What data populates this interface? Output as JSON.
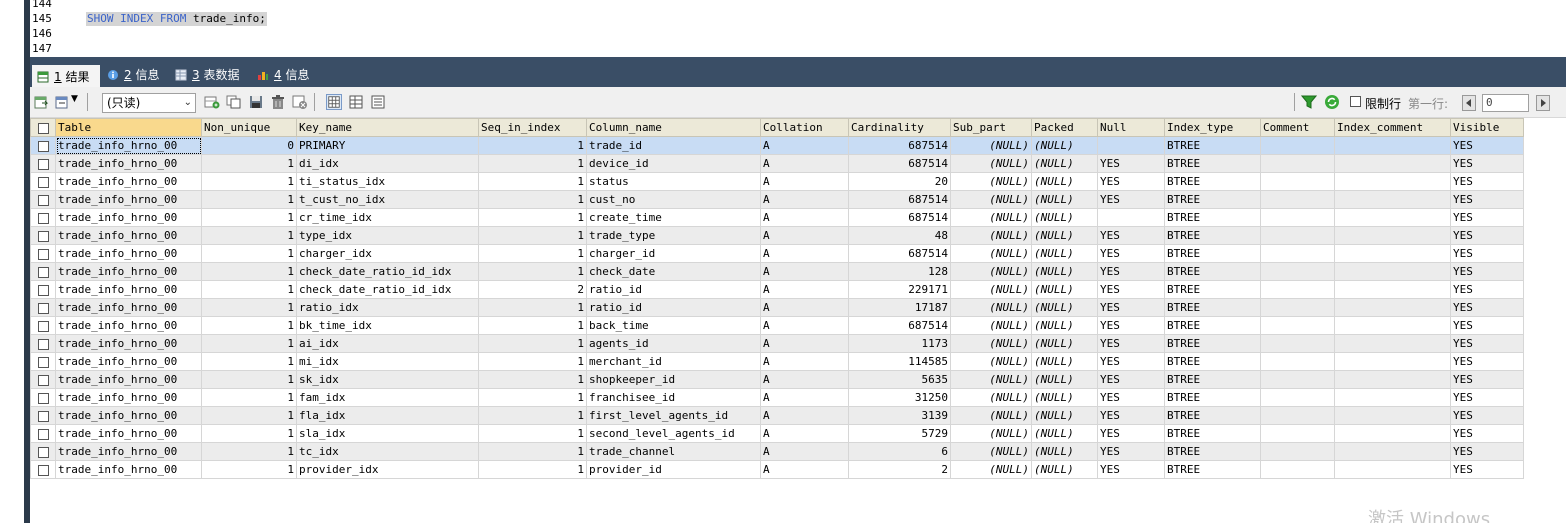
{
  "editor": {
    "lines": [
      {
        "num": "144",
        "code": ""
      },
      {
        "num": "145",
        "code_kw": "SHOW INDEX FROM",
        "code_rest": " trade_info;"
      },
      {
        "num": "146",
        "code": ""
      },
      {
        "num": "147",
        "code": ""
      }
    ]
  },
  "tabs": [
    {
      "num": "1",
      "label": " 结果",
      "icon": "result-grid-icon"
    },
    {
      "num": "2",
      "label": " 信息",
      "icon": "info-icon"
    },
    {
      "num": "3",
      "label": " 表数据",
      "icon": "table-data-icon"
    },
    {
      "num": "4",
      "label": " 信息",
      "icon": "chart-info-icon"
    }
  ],
  "toolbar": {
    "mode_select": "(只读)",
    "limit_rows_label": "限制行",
    "first_row_label": "第一行:",
    "first_row_value": "0"
  },
  "grid": {
    "columns": [
      "Table",
      "Non_unique",
      "Key_name",
      "Seq_in_index",
      "Column_name",
      "Collation",
      "Cardinality",
      "Sub_part",
      "Packed",
      "Null",
      "Index_type",
      "Comment",
      "Index_comment",
      "Visible"
    ],
    "rows": [
      [
        "trade_info_hrno_00",
        "0",
        "PRIMARY",
        "1",
        "trade_id",
        "A",
        "687514",
        "(NULL)",
        "(NULL)",
        "",
        "BTREE",
        "",
        "",
        "YES"
      ],
      [
        "trade_info_hrno_00",
        "1",
        "di_idx",
        "1",
        "device_id",
        "A",
        "687514",
        "(NULL)",
        "(NULL)",
        "YES",
        "BTREE",
        "",
        "",
        "YES"
      ],
      [
        "trade_info_hrno_00",
        "1",
        "ti_status_idx",
        "1",
        "status",
        "A",
        "20",
        "(NULL)",
        "(NULL)",
        "YES",
        "BTREE",
        "",
        "",
        "YES"
      ],
      [
        "trade_info_hrno_00",
        "1",
        "t_cust_no_idx",
        "1",
        "cust_no",
        "A",
        "687514",
        "(NULL)",
        "(NULL)",
        "YES",
        "BTREE",
        "",
        "",
        "YES"
      ],
      [
        "trade_info_hrno_00",
        "1",
        "cr_time_idx",
        "1",
        "create_time",
        "A",
        "687514",
        "(NULL)",
        "(NULL)",
        "",
        "BTREE",
        "",
        "",
        "YES"
      ],
      [
        "trade_info_hrno_00",
        "1",
        "type_idx",
        "1",
        "trade_type",
        "A",
        "48",
        "(NULL)",
        "(NULL)",
        "YES",
        "BTREE",
        "",
        "",
        "YES"
      ],
      [
        "trade_info_hrno_00",
        "1",
        "charger_idx",
        "1",
        "charger_id",
        "A",
        "687514",
        "(NULL)",
        "(NULL)",
        "YES",
        "BTREE",
        "",
        "",
        "YES"
      ],
      [
        "trade_info_hrno_00",
        "1",
        "check_date_ratio_id_idx",
        "1",
        "check_date",
        "A",
        "128",
        "(NULL)",
        "(NULL)",
        "YES",
        "BTREE",
        "",
        "",
        "YES"
      ],
      [
        "trade_info_hrno_00",
        "1",
        "check_date_ratio_id_idx",
        "2",
        "ratio_id",
        "A",
        "229171",
        "(NULL)",
        "(NULL)",
        "YES",
        "BTREE",
        "",
        "",
        "YES"
      ],
      [
        "trade_info_hrno_00",
        "1",
        "ratio_idx",
        "1",
        "ratio_id",
        "A",
        "17187",
        "(NULL)",
        "(NULL)",
        "YES",
        "BTREE",
        "",
        "",
        "YES"
      ],
      [
        "trade_info_hrno_00",
        "1",
        "bk_time_idx",
        "1",
        "back_time",
        "A",
        "687514",
        "(NULL)",
        "(NULL)",
        "YES",
        "BTREE",
        "",
        "",
        "YES"
      ],
      [
        "trade_info_hrno_00",
        "1",
        "ai_idx",
        "1",
        "agents_id",
        "A",
        "1173",
        "(NULL)",
        "(NULL)",
        "YES",
        "BTREE",
        "",
        "",
        "YES"
      ],
      [
        "trade_info_hrno_00",
        "1",
        "mi_idx",
        "1",
        "merchant_id",
        "A",
        "114585",
        "(NULL)",
        "(NULL)",
        "YES",
        "BTREE",
        "",
        "",
        "YES"
      ],
      [
        "trade_info_hrno_00",
        "1",
        "sk_idx",
        "1",
        "shopkeeper_id",
        "A",
        "5635",
        "(NULL)",
        "(NULL)",
        "YES",
        "BTREE",
        "",
        "",
        "YES"
      ],
      [
        "trade_info_hrno_00",
        "1",
        "fam_idx",
        "1",
        "franchisee_id",
        "A",
        "31250",
        "(NULL)",
        "(NULL)",
        "YES",
        "BTREE",
        "",
        "",
        "YES"
      ],
      [
        "trade_info_hrno_00",
        "1",
        "fla_idx",
        "1",
        "first_level_agents_id",
        "A",
        "3139",
        "(NULL)",
        "(NULL)",
        "YES",
        "BTREE",
        "",
        "",
        "YES"
      ],
      [
        "trade_info_hrno_00",
        "1",
        "sla_idx",
        "1",
        "second_level_agents_id",
        "A",
        "5729",
        "(NULL)",
        "(NULL)",
        "YES",
        "BTREE",
        "",
        "",
        "YES"
      ],
      [
        "trade_info_hrno_00",
        "1",
        "tc_idx",
        "1",
        "trade_channel",
        "A",
        "6",
        "(NULL)",
        "(NULL)",
        "YES",
        "BTREE",
        "",
        "",
        "YES"
      ],
      [
        "trade_info_hrno_00",
        "1",
        "provider_idx",
        "1",
        "provider_id",
        "A",
        "2",
        "(NULL)",
        "(NULL)",
        "YES",
        "BTREE",
        "",
        "",
        "YES"
      ]
    ]
  },
  "watermark": "激活 Windows"
}
